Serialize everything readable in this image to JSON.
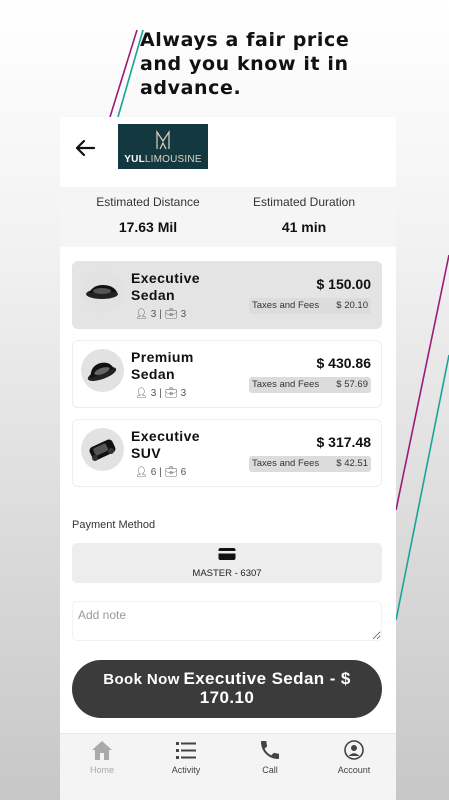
{
  "tagline": "Always a  fair price\n and  you know it in\nadvance.",
  "header": {
    "logo_brand_bold": "YUL",
    "logo_brand_light": "LIMOUSINE"
  },
  "estimates": {
    "distance_label": "Estimated Distance",
    "distance_value": "17.63 Mil",
    "duration_label": "Estimated Duration",
    "duration_value": "41 min"
  },
  "vehicles": [
    {
      "name": "Executive Sedan",
      "passengers": "3",
      "luggage": "3",
      "price": "$ 150.00",
      "fees_label": "Taxes and Fees",
      "fees_value": "$ 20.10",
      "selected": true
    },
    {
      "name": "Premium Sedan",
      "passengers": "3",
      "luggage": "3",
      "price": "$ 430.86",
      "fees_label": "Taxes and Fees",
      "fees_value": "$ 57.69",
      "selected": false
    },
    {
      "name": "Executive SUV",
      "passengers": "6",
      "luggage": "6",
      "price": "$ 317.48",
      "fees_label": "Taxes and Fees",
      "fees_value": "$ 42.51",
      "selected": false
    }
  ],
  "payment": {
    "label": "Payment Method",
    "card": "MASTER - 6307",
    "icon": "credit-card-icon"
  },
  "note": {
    "placeholder": "Add note",
    "value": ""
  },
  "book_button": {
    "prefix": "Book Now",
    "text": "Executive Sedan - $ 170.10"
  },
  "tabs": [
    {
      "label": "Home",
      "icon": "home-icon"
    },
    {
      "label": "Activity",
      "icon": "list-icon"
    },
    {
      "label": "Call",
      "icon": "phone-icon"
    },
    {
      "label": "Account",
      "icon": "user-icon"
    }
  ],
  "colors": {
    "accent_magenta": "#9b1b7a",
    "accent_teal": "#1aa39a",
    "logo_bg": "#13383f",
    "button_bg": "#3b3b3b"
  }
}
